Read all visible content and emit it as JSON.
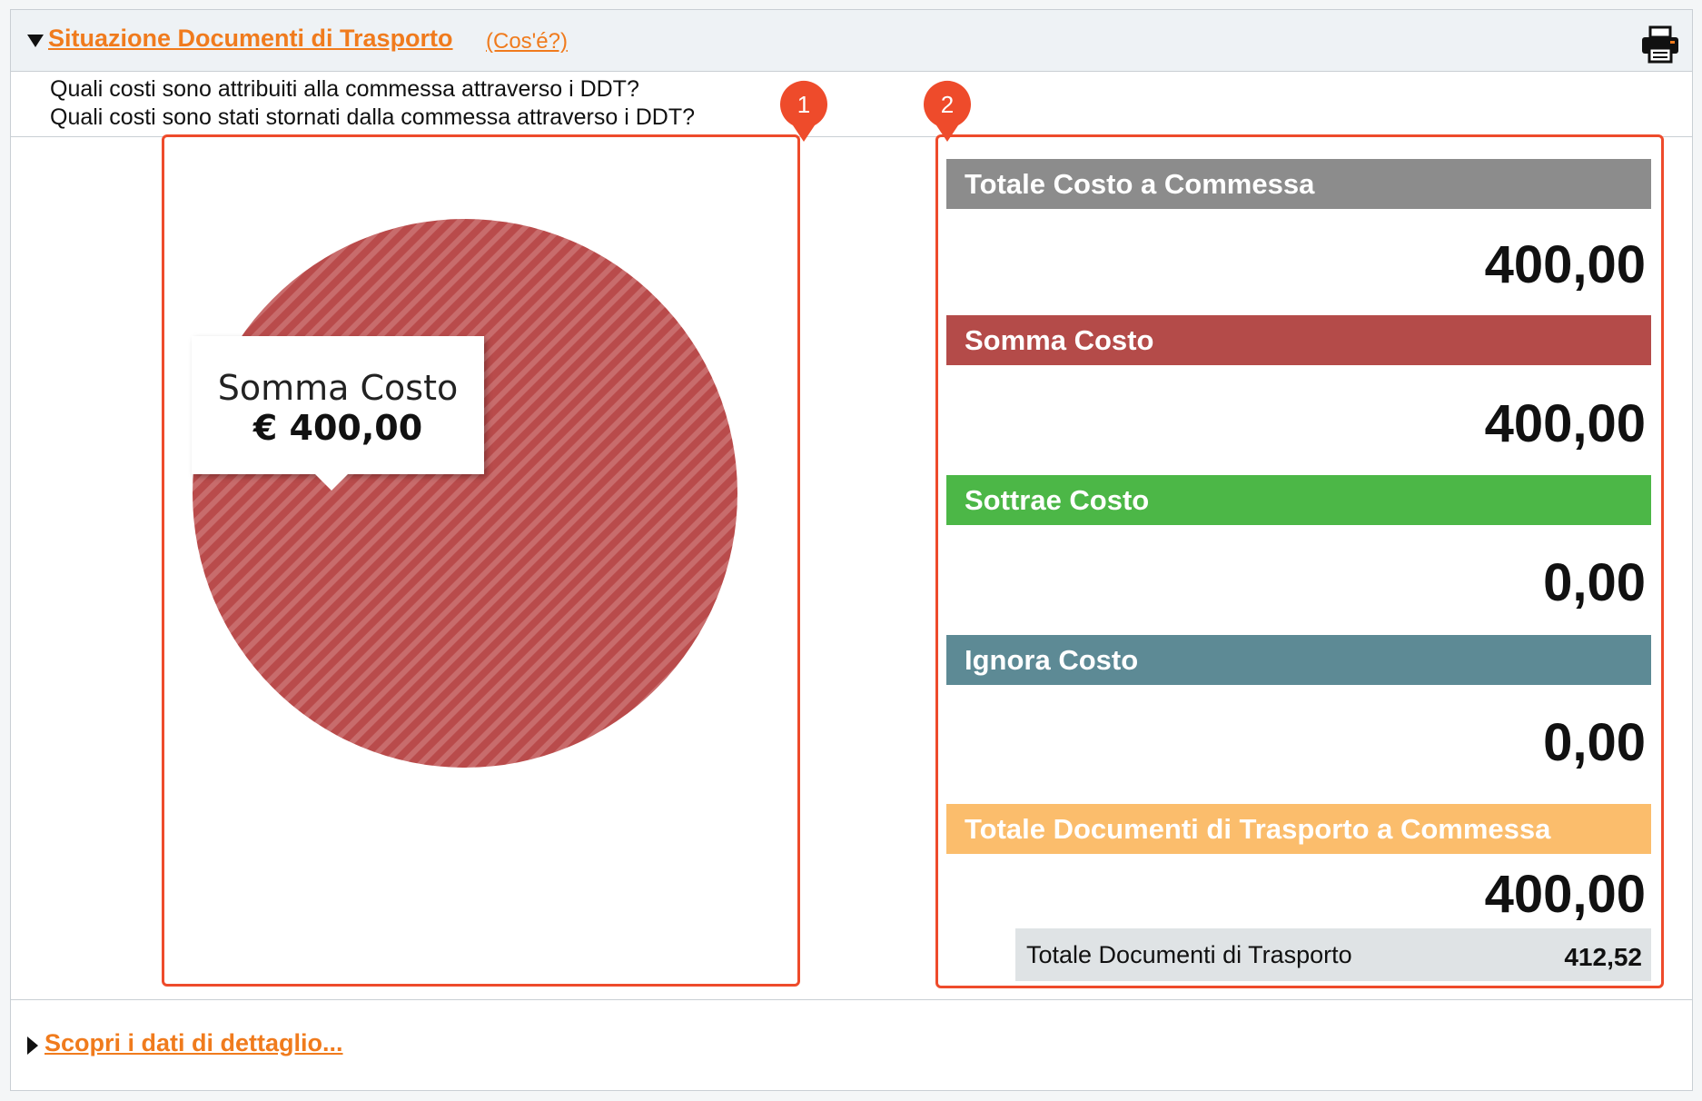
{
  "header": {
    "title": "Situazione Documenti di Trasporto",
    "help_link": "(Cos'é?)"
  },
  "questions": [
    "Quali costi sono attribuiti alla commessa attraverso i DDT?",
    "Quali costi sono stati stornati dalla commessa attraverso i DDT?"
  ],
  "markers": [
    "1",
    "2"
  ],
  "chart_data": {
    "type": "pie",
    "slices": [
      {
        "label": "Somma Costo",
        "value": 400.0,
        "color": "#b94b4b"
      }
    ],
    "tooltip": {
      "label": "Somma Costo",
      "value": "€ 400,00"
    }
  },
  "summary": {
    "totale_costo": {
      "label": "Totale Costo a Commessa",
      "value": "400,00",
      "color": "#8c8c8c"
    },
    "somma_costo": {
      "label": "Somma Costo",
      "value": "400,00",
      "color": "#b44b49"
    },
    "sottrae_costo": {
      "label": "Sottrae Costo",
      "value": "0,00",
      "color": "#4cb747"
    },
    "ignora_costo": {
      "label": "Ignora Costo",
      "value": "0,00",
      "color": "#5d8a95"
    },
    "totale_ddt_commessa": {
      "label": "Totale Documenti di Trasporto a Commessa",
      "value": "400,00",
      "color": "#fbbd6c"
    },
    "totale_ddt": {
      "label": "Totale Documenti di Trasporto",
      "value": "412,52"
    }
  },
  "footer": {
    "details_link": "Scopri i dati di dettaglio..."
  },
  "colors": {
    "accent": "#f07b1d",
    "callout": "#ee4b2b"
  },
  "icons": [
    "collapse-triangle-icon",
    "printer-icon",
    "expand-triangle-icon"
  ]
}
